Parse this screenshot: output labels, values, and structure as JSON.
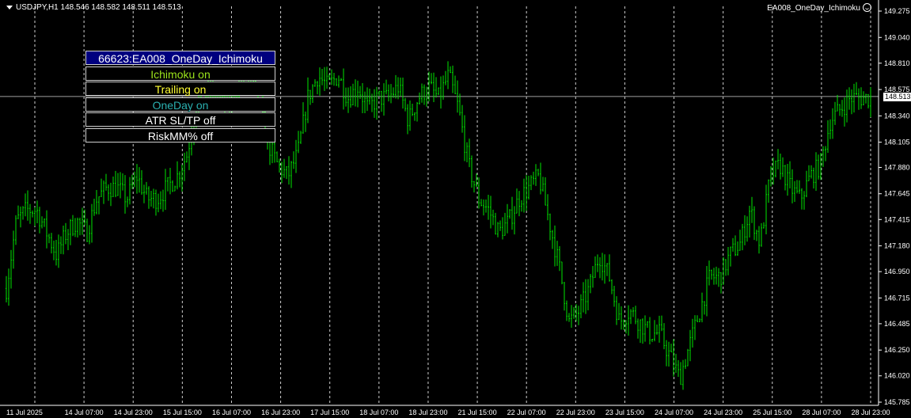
{
  "header": {
    "symbol_info": "USDJPY,H1  148.546 148.582 148.511 148.513",
    "expert_name": "EA008_OneDay_Ichimoku"
  },
  "panel": {
    "title": "66623:EA008_OneDay_Ichimoku",
    "buttons": [
      {
        "label": "Ichimoku on",
        "color": "#9be31d"
      },
      {
        "label": "Trailing  on",
        "color": "#ffff33"
      },
      {
        "label": "OneDay on",
        "color": "#2ab0b0"
      },
      {
        "label": "ATR SL/TP off",
        "color": "#ffffff"
      },
      {
        "label": "RiskMM%   off",
        "color": "#ffffff"
      }
    ]
  },
  "current_price_label": "148.513",
  "colors": {
    "background": "#000000",
    "bars": "#00e600",
    "grid": "#cfcfcf",
    "axis_text": "#ffffff"
  },
  "chart_data": {
    "type": "ohlc",
    "title": "",
    "symbol": "USDJPY",
    "timeframe": "H1",
    "ylim": [
      145.775,
      149.3
    ],
    "y_ticks": [
      "149.275",
      "149.040",
      "148.810",
      "148.575",
      "148.340",
      "148.105",
      "147.880",
      "147.645",
      "147.415",
      "147.180",
      "146.950",
      "146.715",
      "146.485",
      "146.250",
      "146.020",
      "145.785"
    ],
    "x_ticks": [
      "11 Jul 2025",
      "14 Jul 07:00",
      "14 Jul 23:00",
      "15 Jul 15:00",
      "16 Jul 07:00",
      "16 Jul 23:00",
      "17 Jul 15:00",
      "18 Jul 07:00",
      "18 Jul 23:00",
      "21 Jul 15:00",
      "22 Jul 07:00",
      "22 Jul 23:00",
      "23 Jul 15:00",
      "24 Jul 07:00",
      "24 Jul 23:00",
      "25 Jul 15:00",
      "28 Jul 07:00",
      "28 Jul 23:00"
    ],
    "close_path": [
      146.8,
      147.4,
      147.5,
      147.5,
      147.3,
      147.1,
      147.3,
      147.4,
      147.3,
      147.6,
      147.7,
      147.7,
      147.6,
      147.8,
      147.6,
      147.6,
      147.7,
      147.8,
      148.0,
      148.5,
      148.6,
      148.5,
      148.4,
      148.6,
      148.7,
      148.5,
      148.1,
      147.9,
      147.8,
      148.0,
      148.5,
      148.7,
      148.6,
      148.7,
      148.5,
      148.6,
      148.4,
      148.5,
      148.5,
      148.6,
      148.3,
      148.5,
      148.6,
      148.5,
      148.7,
      148.4,
      147.9,
      147.6,
      147.5,
      147.3,
      147.4,
      147.6,
      147.7,
      147.8,
      147.4,
      147.0,
      146.5,
      146.6,
      146.8,
      147.1,
      146.9,
      146.5,
      146.6,
      146.5,
      146.4,
      146.4,
      146.2,
      146.0,
      146.3,
      146.6,
      146.9,
      146.9,
      147.1,
      147.2,
      147.5,
      147.2,
      147.8,
      147.9,
      147.7,
      147.6,
      147.8,
      147.9,
      148.3,
      148.4,
      148.5,
      148.5,
      148.5
    ],
    "current_price": 148.513
  }
}
